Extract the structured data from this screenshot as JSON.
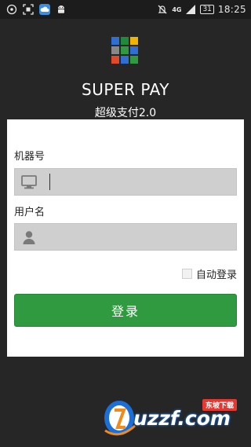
{
  "status_bar": {
    "time": "18:25",
    "battery": "31",
    "network": "4G",
    "icons_left": [
      "notification-icon",
      "scan-icon",
      "cloud-icon",
      "android-icon"
    ],
    "icons_right": [
      "mute-icon",
      "network-icon",
      "signal-icon",
      "battery-icon"
    ]
  },
  "header": {
    "app_name": "SUPER PAY",
    "subtitle": "超级支付2.0",
    "logo_colors": [
      "#2f6fd1",
      "#1f8a3a",
      "#f0b400",
      "#888888",
      "#2f9a3f",
      "#2f6fd1",
      "#e04a28",
      "#2f6fd1",
      "#2f9a3f"
    ]
  },
  "form": {
    "machine_label": "机器号",
    "machine_value": "",
    "username_label": "用户名",
    "username_value": "",
    "remember_label": "自动登录",
    "remember_checked": false,
    "login_label": "登录"
  },
  "watermark": {
    "text": "uzzf.com",
    "tag": "东坡下载"
  },
  "colors": {
    "background": "#262626",
    "card": "#ffffff",
    "input": "#cfcfcf",
    "button": "#2f9a3f"
  }
}
